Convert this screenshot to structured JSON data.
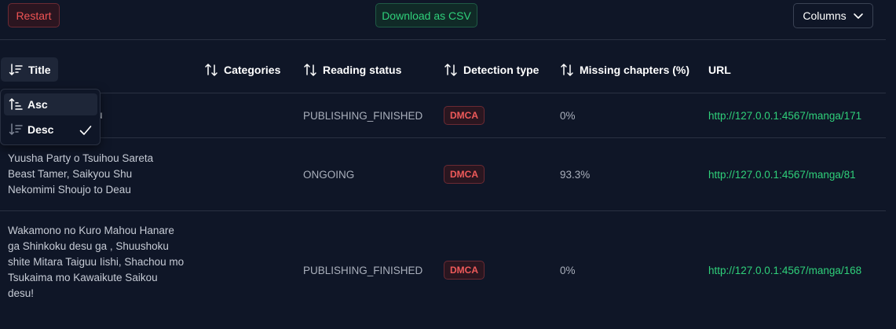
{
  "toolbar": {
    "restart_label": "Restart",
    "csv_label": "Download as CSV",
    "columns_label": "Columns"
  },
  "headers": {
    "title": "Title",
    "categories": "Categories",
    "reading_status": "Reading status",
    "detection_type": "Detection type",
    "missing_chapters": "Missing chapters (%)",
    "url": "URL"
  },
  "sort_menu": {
    "asc": "Asc",
    "desc": "Desc",
    "selected": "Desc"
  },
  "rows": [
    {
      "title": "u",
      "reading_status": "PUBLISHING_FINISHED",
      "detection_type": "DMCA",
      "missing": "0%",
      "url": "http://127.0.0.1:4567/manga/171"
    },
    {
      "title": "Yuusha Party o Tsuihou Sareta Beast Tamer, Saikyou Shu Nekomimi Shoujo to Deau",
      "reading_status": "ONGOING",
      "detection_type": "DMCA",
      "missing": "93.3%",
      "url": "http://127.0.0.1:4567/manga/81"
    },
    {
      "title": "Wakamono no Kuro Mahou Hanare ga Shinkoku desu ga , Shuushoku shite Mitara Taiguu Iishi, Shachou mo Tsukaima mo Kawaikute Saikou desu!",
      "reading_status": "PUBLISHING_FINISHED",
      "detection_type": "DMCA",
      "missing": "0%",
      "url": "http://127.0.0.1:4567/manga/168"
    }
  ],
  "colors": {
    "background": "#0f1627",
    "accent_green": "#2fd07a",
    "danger_red": "#ef5454"
  }
}
